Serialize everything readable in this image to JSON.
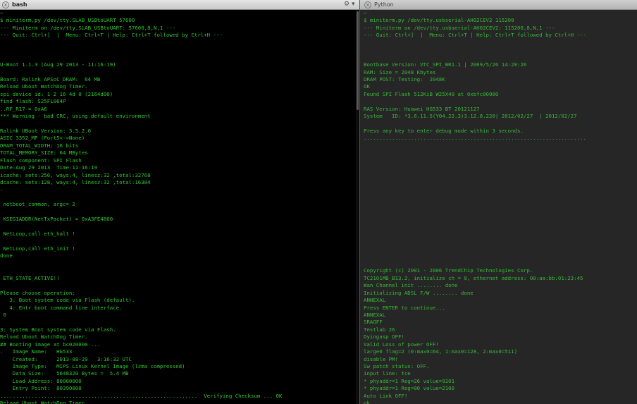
{
  "left_pane": {
    "tab_title": "bash",
    "close_glyph": "×",
    "settings_glyph": "⚙",
    "menu_glyph": "▾",
    "scroll_position": 0.93,
    "lines": [
      "~",
      "$ miniterm.py /dev/tty.SLAB_USBtoUART 57600",
      "--- Miniterm on /dev/tty.SLAB_USBtoUART: 57600,8,N,1 ---",
      "--- Quit: Ctrl+]  |  Menu: Ctrl+T | Help: Ctrl+T followed by Ctrl+H ---",
      "",
      "",
      "",
      "U-Boot 1.1.3 (Aug 29 2013 - 11:16:19)",
      "",
      "Board: Ralink APSoC DRAM:  64 MB",
      "Reload Uboot WatchDog Timer.",
      "spi device id: 1 2 16 4d 0 (2164d00)",
      "find flash: S25FL064P",
      "..RF_R17 = 0xA6",
      "*** Warning - bad CRC, using default environment",
      "",
      "Ralink UBoot Version: 3.5.2.0",
      "ASIC 3352_MP (Port5<->None)",
      "DRAM_TOTAL_WIDTH: 16 bits",
      "TOTAL_MEMORY_SIZE: 64 MBytes",
      "Flash component: SPI Flash",
      "Date:Aug 29 2013  Time:11:16:19",
      "icache: sets:256, ways:4, linesz:32 ,total:32768",
      "dcache: sets:128, ways:4, linesz:32 ,total:16384",
      "-",
      "",
      " netboot_common, argc= 2",
      "",
      " KSEG1ADDR(NetTxPacket) = 0xA3FE4800",
      "",
      " NetLoop,call eth_halt !",
      "",
      " NetLoop,call eth_init !",
      "done",
      "",
      "",
      " ETH_STATE_ACTIVE!!",
      "",
      "Please choose operation:",
      "   3: Boot system code via Flash (default).",
      "   4: Entr boot command line interface.",
      " 0",
      "",
      "3: System Boot system code via Flash.",
      "Reload Uboot WatchDog Timer.",
      "## Booting image at bc020000 ...",
      ".   Image Name:   HG533",
      "    Created:      2013-08-29   3:16:32 UTC",
      "    Image Type:   MIPS Linux Kernel Image (lzma compressed)",
      "    Data Size:    5648320 Bytes =  5.4 MB",
      "    Load Address: 80000000",
      "    Entry Point:  80390000",
      "...............................................................  Verifying Checksum ... OK",
      "Reload Uboot WatchDog Timer."
    ]
  },
  "right_pane": {
    "tab_title": "Python",
    "close_glyph": "×",
    "lines": [
      "~",
      "$ miniterm.py /dev/tty.usbserial-AH02CEV2 115200",
      "--- Miniterm on /dev/tty.usbserial-AH02CEV2: 115200,8,N,1 ---",
      "--- Quit: Ctrl+]  |  Menu: Ctrl+T | Help: Ctrl+T followed by Ctrl+H ---",
      "",
      "",
      "",
      "Bootbase Version: VTC_SPI_BR1.1 | 2009/5/26 14:28:26",
      "RAM: Size = 2048 Kbytes",
      "DRAM POST: Testing:  2048K",
      "OK",
      "Found SPI Flash 512KiB W25X40 at 0xbfc00000",
      "",
      "RAS Version: Huawei HG533 BT 20121127",
      "System   ID: *3.6.11.5(Y04.22.3)3.12.8.220| 2012/02/27  | 2012/02/27",
      "",
      "Press any key to enter debug mode within 3 seconds.",
      ".......................................................................",
      "",
      "",
      "",
      "",
      "",
      "",
      "",
      "",
      "",
      "",
      "",
      "",
      "",
      "",
      "",
      "",
      "",
      "Copyright (c) 2001 - 2006 TrendChip Technologies Corp.",
      "TC2101MB_B13.2, initialize ch = 0, ethernet address: 00:aa:bb:01:23:45",
      "Wan Channel init ........ done",
      "Initializing ADSL F/W ........ done",
      "ANNEXAL",
      "Press ENTER to continue...",
      "ANNEXAL",
      "SRAOFF",
      "Testlab 26",
      "Dyingasp OFF!",
      "Valid Loss of power OFF!",
      "large0 flag=2 (0:max0=64, 1:max0=128, 2:max0=511)",
      "disable PM!",
      "Sw patch status: OFF.",
      "input line: tce",
      "* phyaddr=1 Reg=26 value=9201",
      "* phyaddr=1 Reg=00 value=2100",
      "Auto Link OFF!",
      "ok"
    ]
  }
}
